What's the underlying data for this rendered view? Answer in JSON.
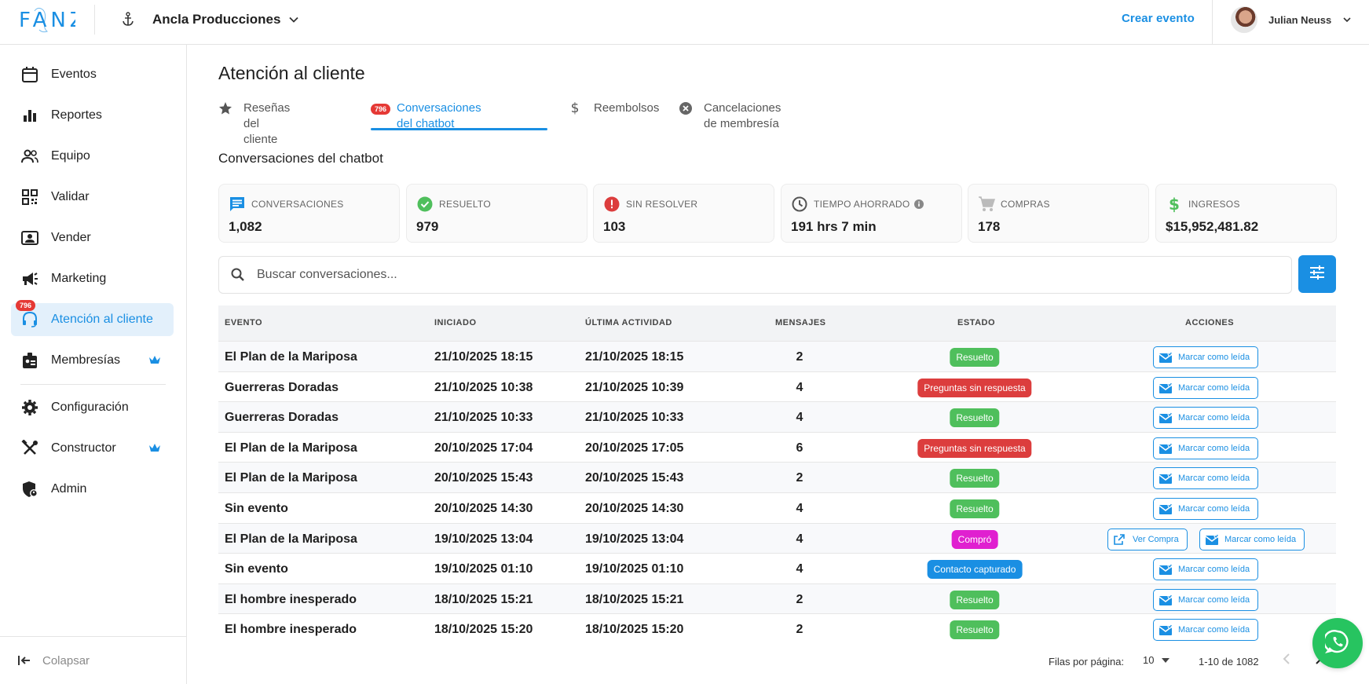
{
  "header": {
    "logo_text": "FANZ",
    "org_name": "Ancla Producciones",
    "create_label": "Crear evento",
    "user_name": "Julian Neuss"
  },
  "sidebar": {
    "items": [
      {
        "label": "Eventos",
        "icon": "calendar-icon"
      },
      {
        "label": "Reportes",
        "icon": "bar-chart-icon"
      },
      {
        "label": "Equipo",
        "icon": "people-icon"
      },
      {
        "label": "Validar",
        "icon": "qr-code-icon"
      },
      {
        "label": "Vender",
        "icon": "contact-card-icon"
      },
      {
        "label": "Marketing",
        "icon": "megaphone-icon"
      },
      {
        "label": "Atención al cliente",
        "icon": "headset-icon",
        "badge": "796",
        "active": true
      },
      {
        "label": "Membresías",
        "icon": "badge-icon",
        "premium": true
      },
      {
        "label": "Configuración",
        "icon": "gear-icon"
      },
      {
        "label": "Constructor",
        "icon": "tools-icon",
        "premium": true
      },
      {
        "label": "Admin",
        "icon": "admin-shield-icon"
      }
    ],
    "collapse_label": "Colapsar"
  },
  "main": {
    "title": "Atención al cliente",
    "tabs": [
      {
        "label": "Reseñas del cliente",
        "icon": "star-icon"
      },
      {
        "label": "Conversaciones del chatbot",
        "badge": "796",
        "active": true
      },
      {
        "label": "Reembolsos",
        "icon": "dollar-icon"
      },
      {
        "label": "Cancelaciones de membresía",
        "icon": "cancel-circle-icon"
      }
    ],
    "section_title": "Conversaciones del chatbot",
    "stats": [
      {
        "label": "CONVERSACIONES",
        "value": "1,082",
        "icon": "chat-icon",
        "color": "#1a8fe3"
      },
      {
        "label": "RESUELTO",
        "value": "979",
        "icon": "check-circle-icon",
        "color": "#4fbf5c"
      },
      {
        "label": "SIN RESOLVER",
        "value": "103",
        "icon": "alert-circle-icon",
        "color": "#dc3d3d"
      },
      {
        "label": "TIEMPO AHORRADO",
        "value": "191 hrs 7 min",
        "icon": "clock-icon",
        "color": "#555555"
      },
      {
        "label": "COMPRAS",
        "value": "178",
        "icon": "cart-icon",
        "color": "#bbbbbb"
      },
      {
        "label": "INGRESOS",
        "value": "$15,952,481.82",
        "icon": "dollar-icon",
        "color": "#4fbf5c"
      }
    ],
    "search_placeholder": "Buscar conversaciones..."
  },
  "table": {
    "columns": [
      "EVENTO",
      "INICIADO",
      "ÚLTIMA ACTIVIDAD",
      "MENSAJES",
      "ESTADO",
      "ACCIONES"
    ],
    "rows": [
      {
        "evento": "El Plan de la Mariposa",
        "iniciado": "21/10/2025 18:15",
        "ultima": "21/10/2025 18:15",
        "mensajes": "2",
        "estado": "Resuelto",
        "estado_color": "#4fbf5c",
        "acciones": [
          "Marcar como leída"
        ]
      },
      {
        "evento": "Guerreras Doradas",
        "iniciado": "21/10/2025 10:38",
        "ultima": "21/10/2025 10:39",
        "mensajes": "4",
        "estado": "Preguntas sin respuesta",
        "estado_color": "#dc3d3d",
        "acciones": [
          "Marcar como leída"
        ]
      },
      {
        "evento": "Guerreras Doradas",
        "iniciado": "21/10/2025 10:33",
        "ultima": "21/10/2025 10:33",
        "mensajes": "4",
        "estado": "Resuelto",
        "estado_color": "#4fbf5c",
        "acciones": [
          "Marcar como leída"
        ]
      },
      {
        "evento": "El Plan de la Mariposa",
        "iniciado": "20/10/2025 17:04",
        "ultima": "20/10/2025 17:05",
        "mensajes": "6",
        "estado": "Preguntas sin respuesta",
        "estado_color": "#dc3d3d",
        "acciones": [
          "Marcar como leída"
        ]
      },
      {
        "evento": "El Plan de la Mariposa",
        "iniciado": "20/10/2025 15:43",
        "ultima": "20/10/2025 15:43",
        "mensajes": "2",
        "estado": "Resuelto",
        "estado_color": "#4fbf5c",
        "acciones": [
          "Marcar como leída"
        ]
      },
      {
        "evento": "Sin evento",
        "iniciado": "20/10/2025 14:30",
        "ultima": "20/10/2025 14:30",
        "mensajes": "4",
        "estado": "Resuelto",
        "estado_color": "#4fbf5c",
        "acciones": [
          "Marcar como leída"
        ]
      },
      {
        "evento": "El Plan de la Mariposa",
        "iniciado": "19/10/2025 13:04",
        "ultima": "19/10/2025 13:04",
        "mensajes": "4",
        "estado": "Compró",
        "estado_color": "#e020d0",
        "acciones": [
          "Ver Compra",
          "Marcar como leída"
        ]
      },
      {
        "evento": "Sin evento",
        "iniciado": "19/10/2025 01:10",
        "ultima": "19/10/2025 01:10",
        "mensajes": "4",
        "estado": "Contacto capturado",
        "estado_color": "#1a8fe3",
        "acciones": [
          "Marcar como leída"
        ]
      },
      {
        "evento": "El hombre inesperado",
        "iniciado": "18/10/2025 15:21",
        "ultima": "18/10/2025 15:21",
        "mensajes": "2",
        "estado": "Resuelto",
        "estado_color": "#4fbf5c",
        "acciones": [
          "Marcar como leída"
        ]
      },
      {
        "evento": "El hombre inesperado",
        "iniciado": "18/10/2025 15:20",
        "ultima": "18/10/2025 15:20",
        "mensajes": "2",
        "estado": "Resuelto",
        "estado_color": "#4fbf5c",
        "acciones": [
          "Marcar como leída"
        ]
      }
    ]
  },
  "pagination": {
    "rows_per_page_label": "Filas por página:",
    "rows_per_page_value": "10",
    "range": "1-10 de 1082"
  }
}
